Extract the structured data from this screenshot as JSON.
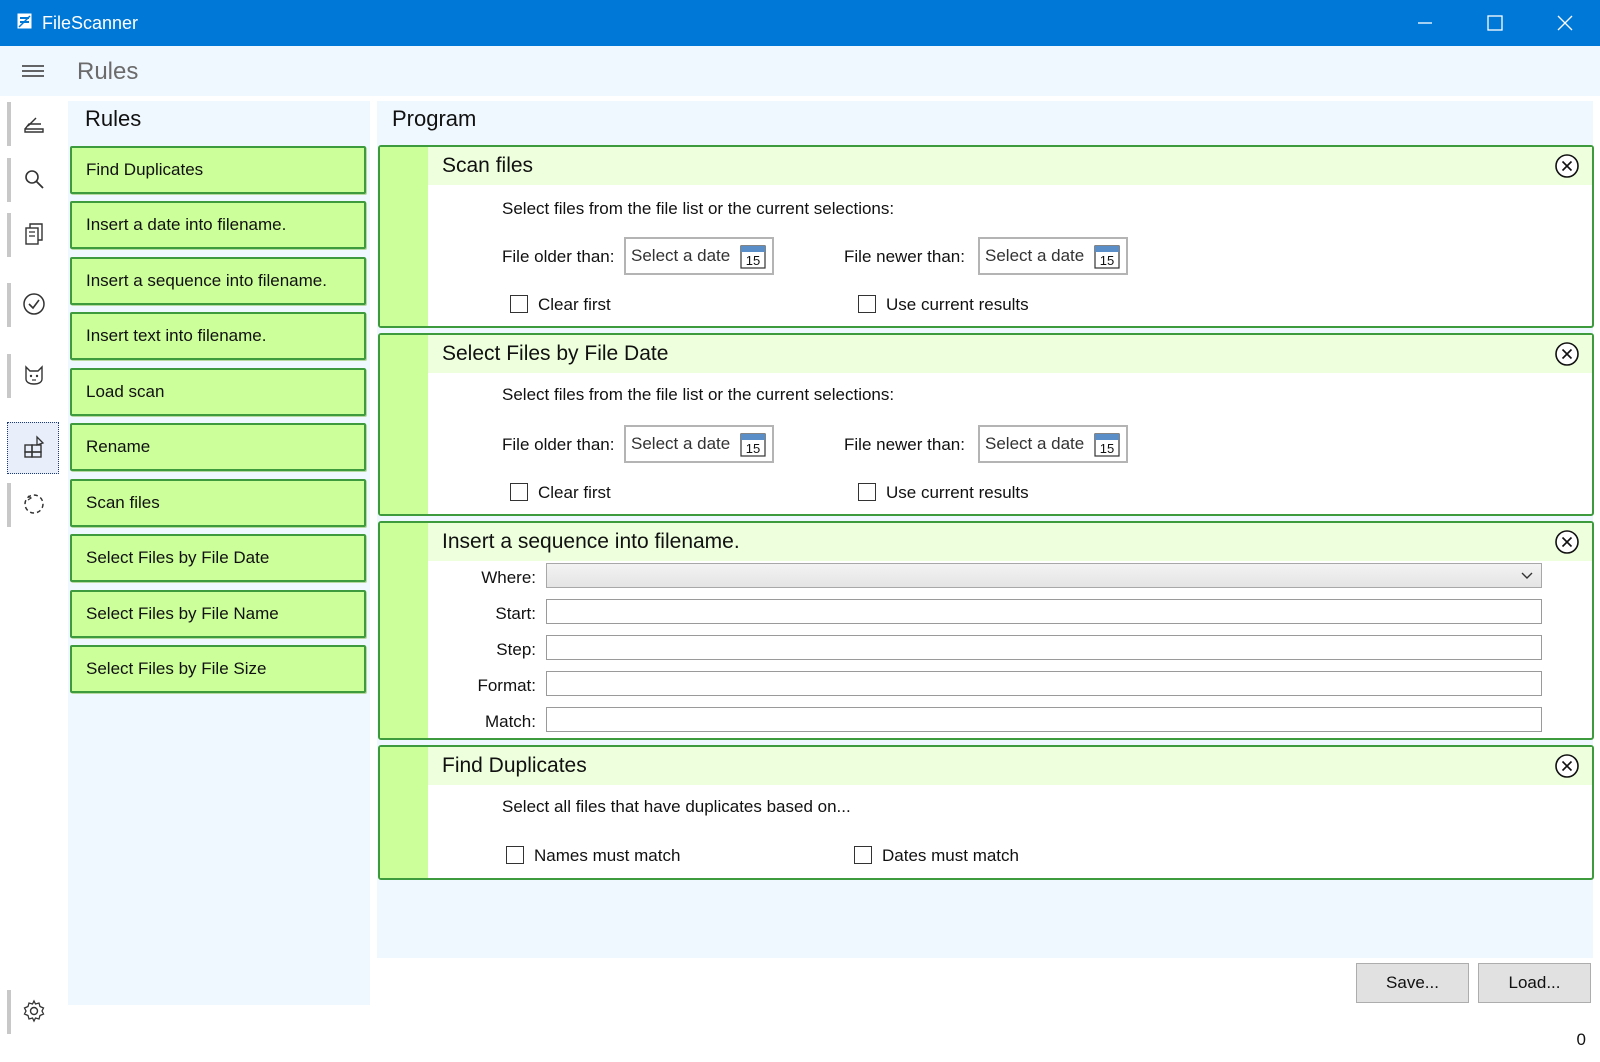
{
  "window": {
    "title": "FileScanner"
  },
  "header": {
    "page_title": "Rules"
  },
  "rail": {
    "items": [
      "scanner-icon",
      "search-icon",
      "copy-icon",
      "check-circle-icon",
      "cat-icon",
      "rules-icon",
      "loading-icon"
    ],
    "bottom": "settings-icon"
  },
  "rules": {
    "heading": "Rules",
    "items": [
      "Find Duplicates",
      "Insert a date into filename.",
      "Insert a sequence into filename.",
      "Insert text into filename.",
      "Load scan",
      "Rename",
      "Scan files",
      "Select Files by File Date",
      "Select Files by File Name",
      "Select Files by File Size"
    ]
  },
  "program": {
    "heading": "Program",
    "cards": [
      {
        "title": "Scan files",
        "description": "Select files from the file list or the current selections:",
        "older_label": "File older than:",
        "newer_label": "File newer than:",
        "date_placeholder": "Select a date",
        "calendar_day": "15",
        "clear_first": "Clear first",
        "use_current": "Use current results"
      },
      {
        "title": "Select Files by File Date",
        "description": "Select files from the file list or the current selections:",
        "older_label": "File older than:",
        "newer_label": "File newer than:",
        "date_placeholder": "Select a date",
        "calendar_day": "15",
        "clear_first": "Clear first",
        "use_current": "Use current results"
      },
      {
        "title": "Insert a sequence into filename.",
        "where_label": "Where:",
        "start_label": "Start:",
        "step_label": "Step:",
        "format_label": "Format:",
        "match_label": "Match:",
        "where_value": "",
        "start_value": "",
        "step_value": "",
        "format_value": "",
        "match_value": ""
      },
      {
        "title": "Find Duplicates",
        "description": "Select all files that have duplicates based on...",
        "names_match": "Names must match",
        "dates_match": "Dates must match"
      }
    ]
  },
  "actions": {
    "save": "Save...",
    "load": "Load..."
  },
  "status": {
    "count": "0"
  },
  "colors": {
    "accent": "#0078d7",
    "rule_fill": "#ccff99",
    "rule_border": "#3d9a3d",
    "panel_bg": "#f0f8ff"
  }
}
